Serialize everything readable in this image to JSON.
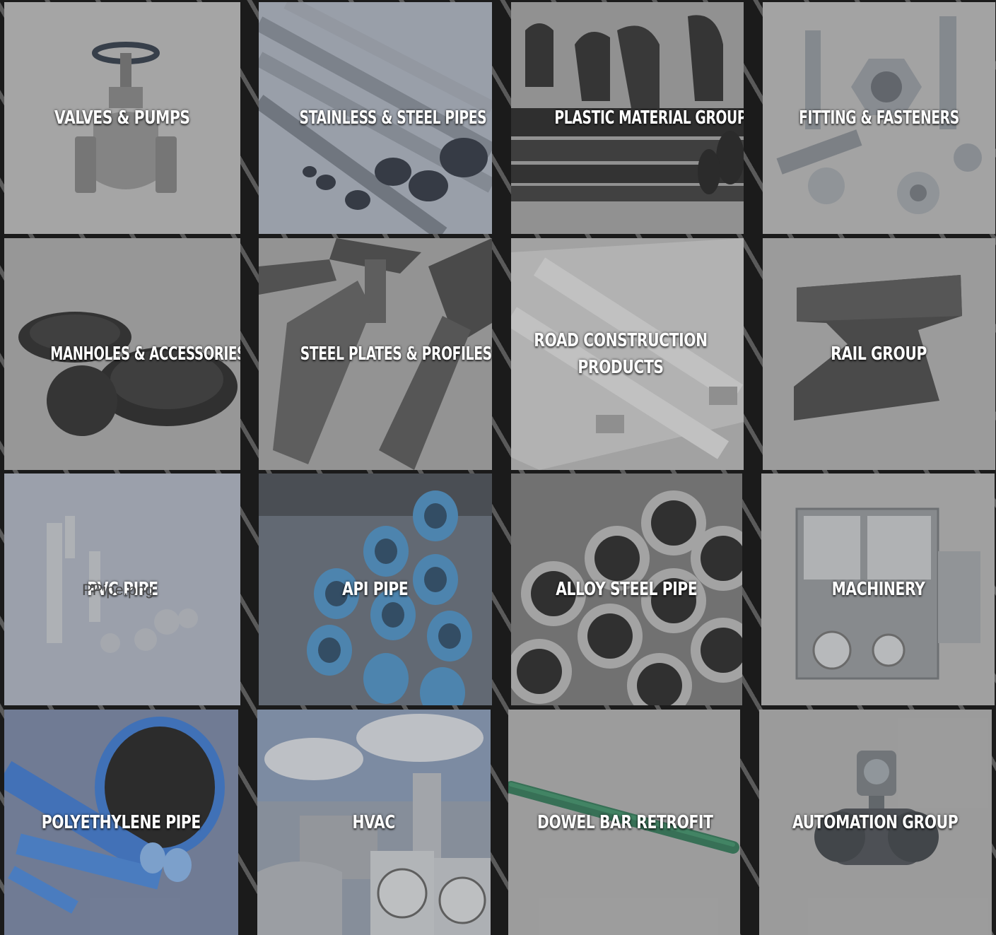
{
  "tiles": [
    {
      "label": "VALVES & PUMPS",
      "icon": "valve-icon",
      "bg": "#b7b7b7"
    },
    {
      "label": "STAINLESS & STEEL PIPES",
      "icon": "steel-pipes-icon",
      "bg": "#a7afbd"
    },
    {
      "label": "PLASTIC MATERIAL GROUPS",
      "icon": "plastic-pipes-icon",
      "bg": "#9b9b9b"
    },
    {
      "label": "FITTING & FASTENERS",
      "icon": "fasteners-icon",
      "bg": "#b4b4b4"
    },
    {
      "label": "MANHOLES & ACCESSORIES",
      "icon": "manhole-icon",
      "bg": "#a4a4a4"
    },
    {
      "label": "STEEL PLATES & PROFILES",
      "icon": "steel-profiles-icon",
      "bg": "#9f9f9f"
    },
    {
      "label": "ROAD CONSTRUCTION PRODUCTS",
      "icon": "road-products-icon",
      "bg": "#b3b3b3"
    },
    {
      "label": "RAIL GROUP",
      "icon": "rail-icon",
      "bg": "#a9a9a9"
    },
    {
      "label": "PVC PIPE",
      "icon": "pvc-pipe-icon",
      "bg": "#a9b1c0"
    },
    {
      "label": "API PIPE",
      "icon": "api-pipe-icon",
      "bg": "#5a6472"
    },
    {
      "label": "ALLOY STEEL PIPE",
      "icon": "alloy-pipe-icon",
      "bg": "#6f6f6f"
    },
    {
      "label": "MACHINERY",
      "icon": "machinery-icon",
      "bg": "#b0b0b0"
    },
    {
      "label": "POLYETHYLENE PIPE",
      "icon": "polyethylene-pipe-icon",
      "bg": "#6e7da0"
    },
    {
      "label": "HVAC",
      "icon": "hvac-icon",
      "bg": "#8d98a8"
    },
    {
      "label": "DOWEL BAR RETROFIT",
      "icon": "dowel-bar-icon",
      "bg": "#ababab"
    },
    {
      "label": "AUTOMATION GROUP",
      "icon": "automation-icon",
      "bg": "#aaaaaa"
    }
  ],
  "broken_image_alt": "PPipe.png"
}
